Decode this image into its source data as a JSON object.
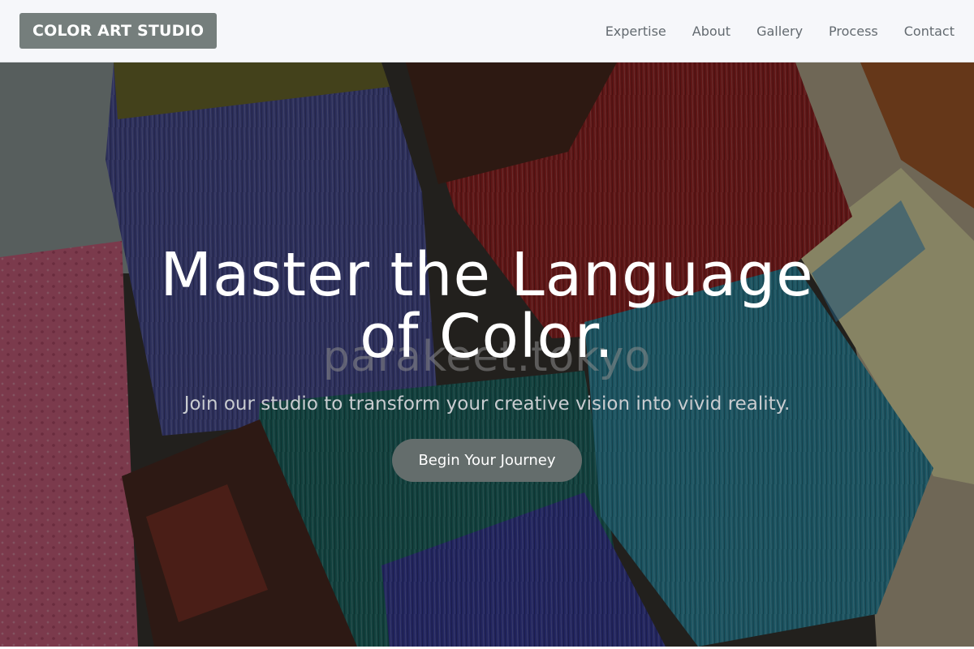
{
  "header": {
    "brand": "COLOR ART STUDIO",
    "nav": [
      "Expertise",
      "About",
      "Gallery",
      "Process",
      "Contact"
    ]
  },
  "hero": {
    "headline_line1": "Master the Language",
    "headline_line2": "of Color.",
    "watermark": "parakeet.tokyo",
    "subtitle": "Join our studio to transform your creative vision into vivid reality.",
    "cta": "Begin Your Journey"
  },
  "colors": {
    "header_bg": "#f6f7fa",
    "brand_bg": "#757e7c",
    "nav_text": "#636a70",
    "cta_bg": "#646d6c"
  },
  "icons": [
    "paint-brushes-background-image"
  ]
}
